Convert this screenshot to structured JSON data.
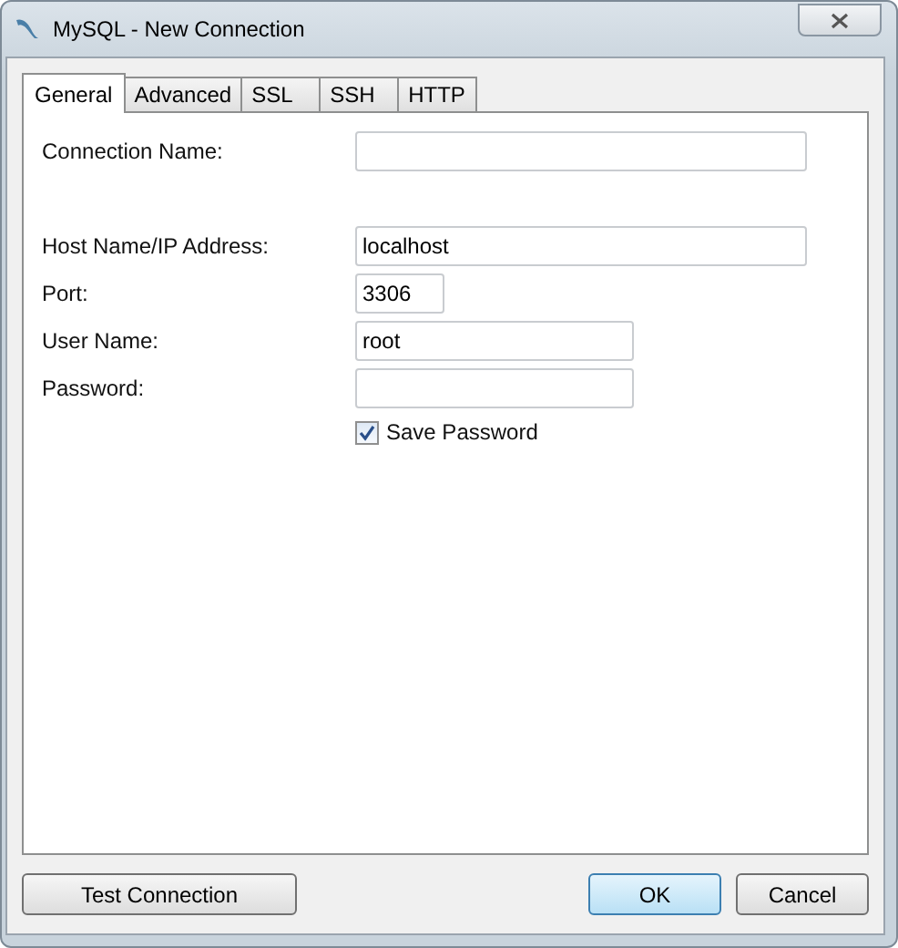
{
  "window": {
    "title": "MySQL - New Connection"
  },
  "tabs": [
    {
      "label": "General",
      "selected": true
    },
    {
      "label": "Advanced",
      "selected": false
    },
    {
      "label": "SSL",
      "selected": false
    },
    {
      "label": "SSH",
      "selected": false
    },
    {
      "label": "HTTP",
      "selected": false
    }
  ],
  "connection_name": {
    "label": "Connection Name:"
  },
  "fields": [
    {
      "label": "Host Name/IP Address:",
      "value": "localhost",
      "kind": "long"
    },
    {
      "label": "Port:",
      "value": "3306",
      "kind": "short"
    },
    {
      "label": "User Name:",
      "value": "root",
      "kind": "medium"
    },
    {
      "label": "Password:",
      "kind": "medium"
    }
  ],
  "save_password": {
    "label": "Save Password",
    "checked": true
  },
  "buttons": {
    "test": "Test Connection",
    "ok": "OK",
    "cancel": "Cancel"
  }
}
